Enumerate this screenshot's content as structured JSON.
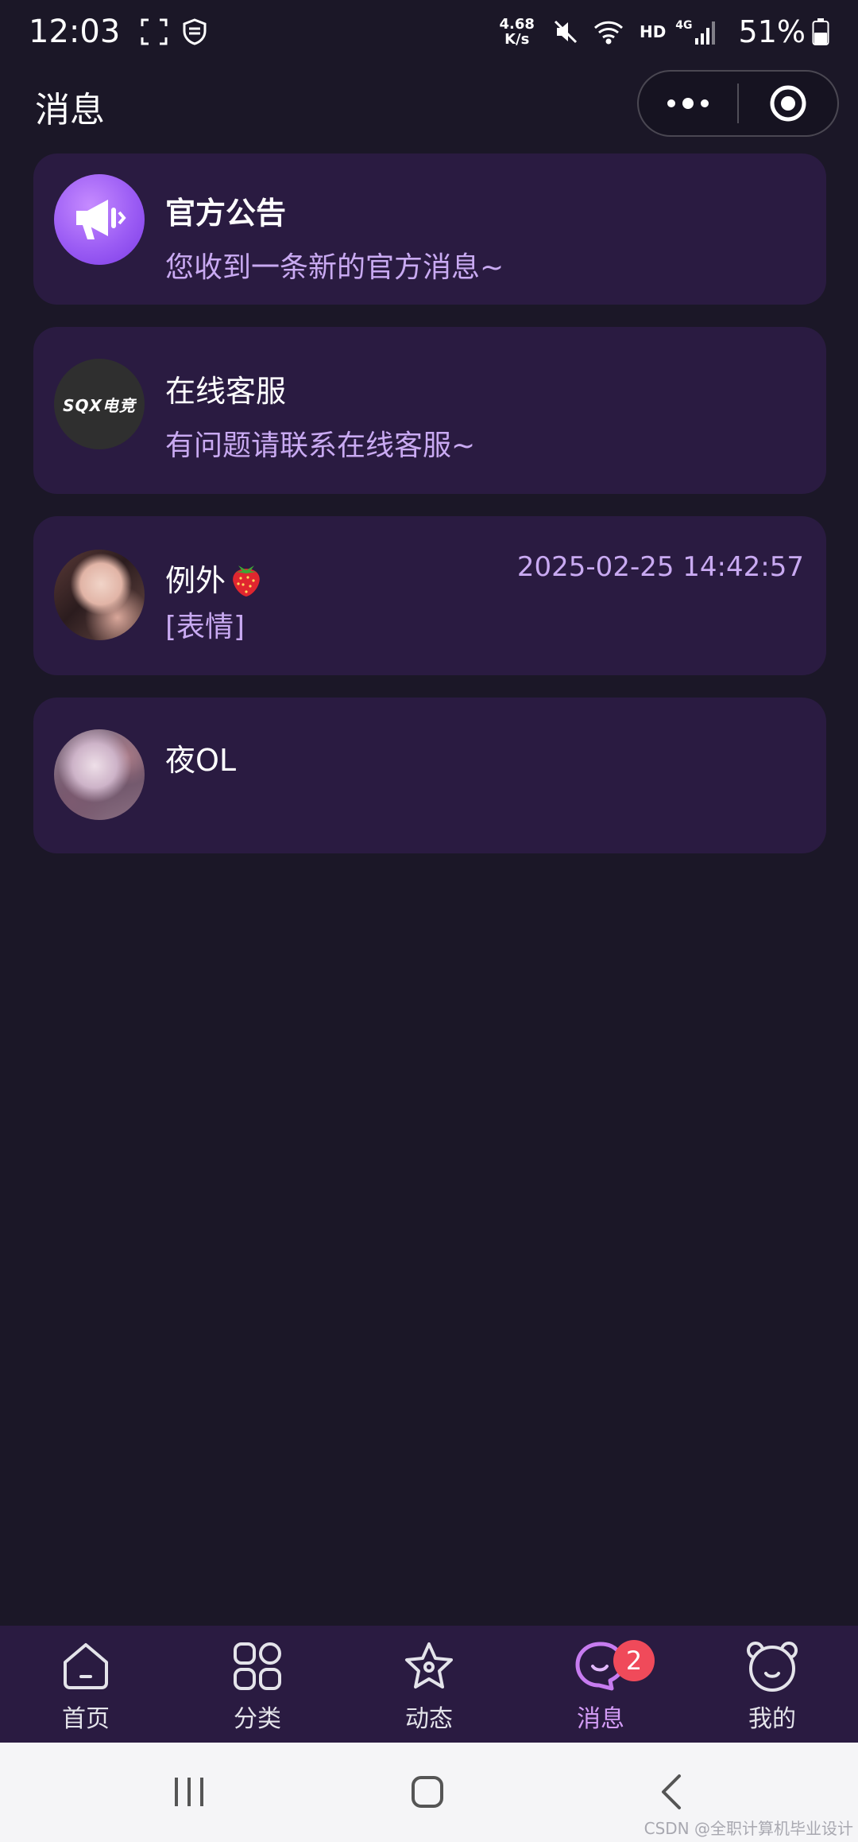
{
  "status_bar": {
    "time": "12:03",
    "net_speed_value": "4.68",
    "net_speed_unit": "K/s",
    "hd_label": "HD",
    "network_label": "4G",
    "battery": "51%"
  },
  "header": {
    "title": "消息"
  },
  "messages": [
    {
      "name": "官方公告",
      "preview": "您收到一条新的官方消息~",
      "time": ""
    },
    {
      "name": "在线客服",
      "preview": "有问题请联系在线客服~",
      "avatar_text": "SQX电竞",
      "time": ""
    },
    {
      "name": "例外",
      "preview": "[表情]",
      "time": "2025-02-25 14:42:57"
    },
    {
      "name": "夜OL",
      "preview": "",
      "time": ""
    }
  ],
  "tab_bar": {
    "items": [
      {
        "label": "首页",
        "icon": "home-icon"
      },
      {
        "label": "分类",
        "icon": "grid-icon"
      },
      {
        "label": "动态",
        "icon": "star-icon"
      },
      {
        "label": "消息",
        "icon": "chat-icon",
        "badge": "2"
      },
      {
        "label": "我的",
        "icon": "bear-icon"
      }
    ],
    "active_index": 3
  },
  "watermark": "CSDN @全职计算机毕业设计",
  "colors": {
    "background": "#1b1727",
    "card": "#2a1b41",
    "accent": "#c9aaf2",
    "badge": "#f04a5a"
  }
}
